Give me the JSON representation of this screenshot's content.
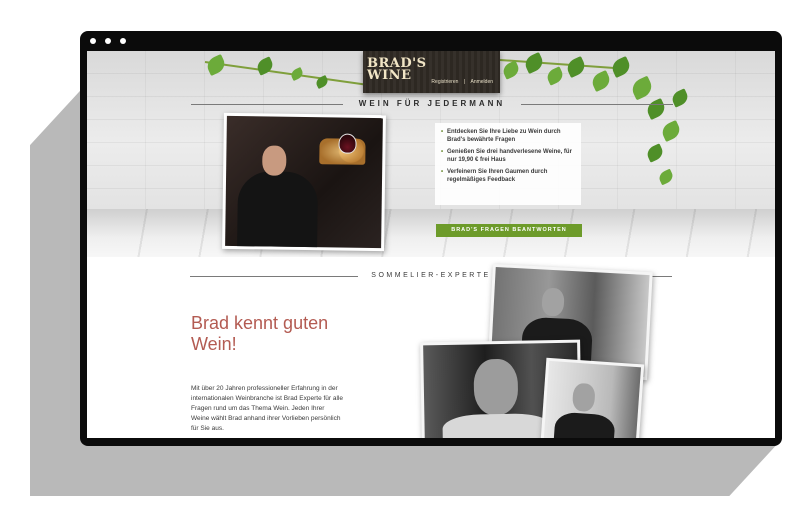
{
  "header": {
    "brand_line1": "BRAD'S",
    "brand_line2": "WINE",
    "links": [
      {
        "label": "Registrieren"
      },
      {
        "label": "|"
      },
      {
        "label": "Anmelden"
      }
    ]
  },
  "hero": {
    "headline": "WEIN FÜR JEDERMANN",
    "bullets": [
      "Entdecken Sie Ihre Liebe zu Wein durch Brad's bewährte Fragen",
      "Genießen Sie drei handverlesene Weine, für nur 19,90 € frei Haus",
      "Verfeinern Sie Ihren Gaumen durch regelmäßiges Feedback"
    ],
    "cta_label": "BRAD'S FRAGEN BEANTWORTEN"
  },
  "section": {
    "title": "SOMMELIER-EXPERTE",
    "lead": "Brad kennt guten Wein!",
    "paragraph": "Mit über 20 Jahren professioneller Erfahrung in der internationalen Weinbranche ist Brad Experte für alle Fragen rund um das Thema Wein. Jeden Ihrer Weine wählt Brad anhand ihrer Vorlieben persönlich für Sie aus."
  },
  "colors": {
    "accent_green": "#6d9b2a",
    "lead_red": "#b35b52",
    "logo_board": "#2f2a24"
  }
}
